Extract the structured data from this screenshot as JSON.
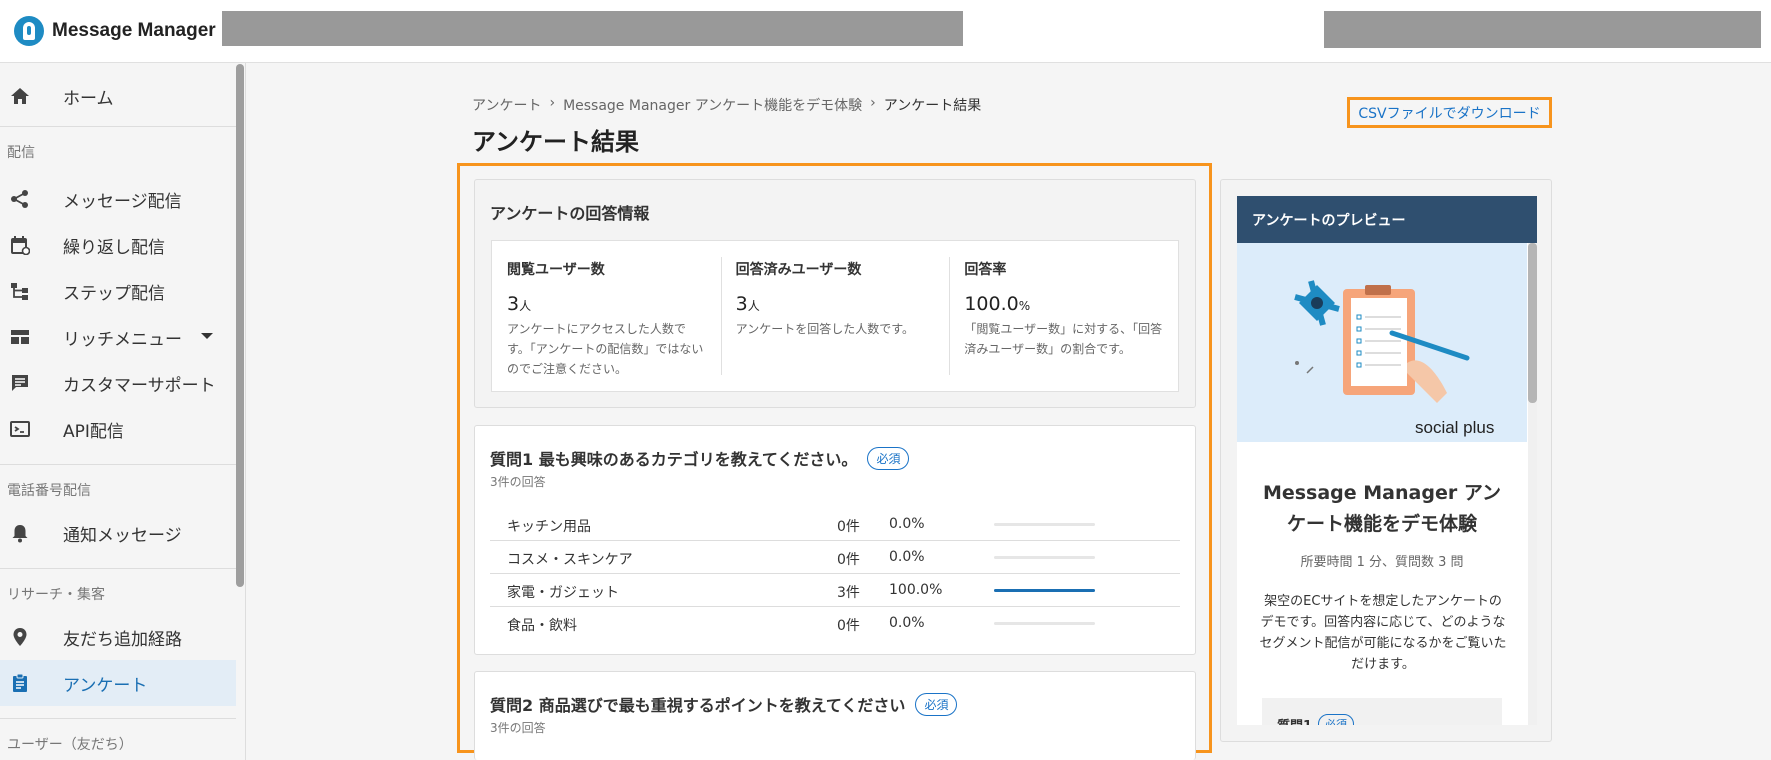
{
  "app": {
    "name": "Message Manager"
  },
  "sidebar": {
    "items": [
      {
        "label": "ホーム",
        "icon": "home-icon"
      },
      {
        "label": "メッセージ配信",
        "icon": "share-icon"
      },
      {
        "label": "繰り返し配信",
        "icon": "calendar-repeat-icon"
      },
      {
        "label": "ステップ配信",
        "icon": "step-tree-icon"
      },
      {
        "label": "リッチメニュー",
        "icon": "rich-menu-icon"
      },
      {
        "label": "カスタマーサポート",
        "icon": "chat-icon"
      },
      {
        "label": "API配信",
        "icon": "terminal-icon"
      },
      {
        "label": "通知メッセージ",
        "icon": "bell-icon"
      },
      {
        "label": "友だち追加経路",
        "icon": "location-pin-icon"
      },
      {
        "label": "アンケート",
        "icon": "clipboard-icon"
      }
    ],
    "sections": {
      "delivery": "配信",
      "phone": "電話番号配信",
      "research": "リサーチ・集客",
      "users": "ユーザー（友だち）"
    }
  },
  "breadcrumb": {
    "root": "アンケート",
    "parent": "Message Manager アンケート機能をデモ体験",
    "current": "アンケート結果",
    "separator": "›"
  },
  "page": {
    "title": "アンケート結果",
    "csv_label": "CSVファイルでダウンロード"
  },
  "info": {
    "title": "アンケートの回答情報",
    "stats": [
      {
        "label": "閲覧ユーザー数",
        "value": "3",
        "unit": "人",
        "desc": "アンケートにアクセスした人数です。「アンケートの配信数」ではないのでご注意ください。"
      },
      {
        "label": "回答済みユーザー数",
        "value": "3",
        "unit": "人",
        "desc": "アンケートを回答した人数です。"
      },
      {
        "label": "回答率",
        "value": "100.0",
        "unit": "%",
        "desc": "「閲覧ユーザー数」に対する、「回答済みユーザー数」の割合です。"
      }
    ]
  },
  "questions": [
    {
      "title": "質問1 最も興味のあるカテゴリを教えてください。",
      "badge": "必須",
      "count": "3件の回答",
      "options": [
        {
          "label": "キッチン用品",
          "count": "0件",
          "pct": "0.0%",
          "ratio": 0
        },
        {
          "label": "コスメ・スキンケア",
          "count": "0件",
          "pct": "0.0%",
          "ratio": 0
        },
        {
          "label": "家電・ガジェット",
          "count": "3件",
          "pct": "100.0%",
          "ratio": 1
        },
        {
          "label": "食品・飲料",
          "count": "0件",
          "pct": "0.0%",
          "ratio": 0
        }
      ]
    },
    {
      "title": "質問2 商品選びで最も重視するポイントを教えてください",
      "badge": "必須",
      "count": "3件の回答"
    }
  ],
  "preview": {
    "header": "アンケートのプレビュー",
    "brand": "social plus",
    "title": "Message Manager アンケート機能をデモ体験",
    "sub": "所要時間 1 分、質問数 3 問",
    "desc": "架空のECサイトを想定したアンケートのデモです。回答内容に応じて、どのようなセグメント配信が可能になるかをご覧いただけます。",
    "q_label": "質問1",
    "q_badge": "必須"
  },
  "colors": {
    "accent": "#1a6fb3",
    "highlight": "#f7941d",
    "preview_header": "#2f4f6f"
  }
}
